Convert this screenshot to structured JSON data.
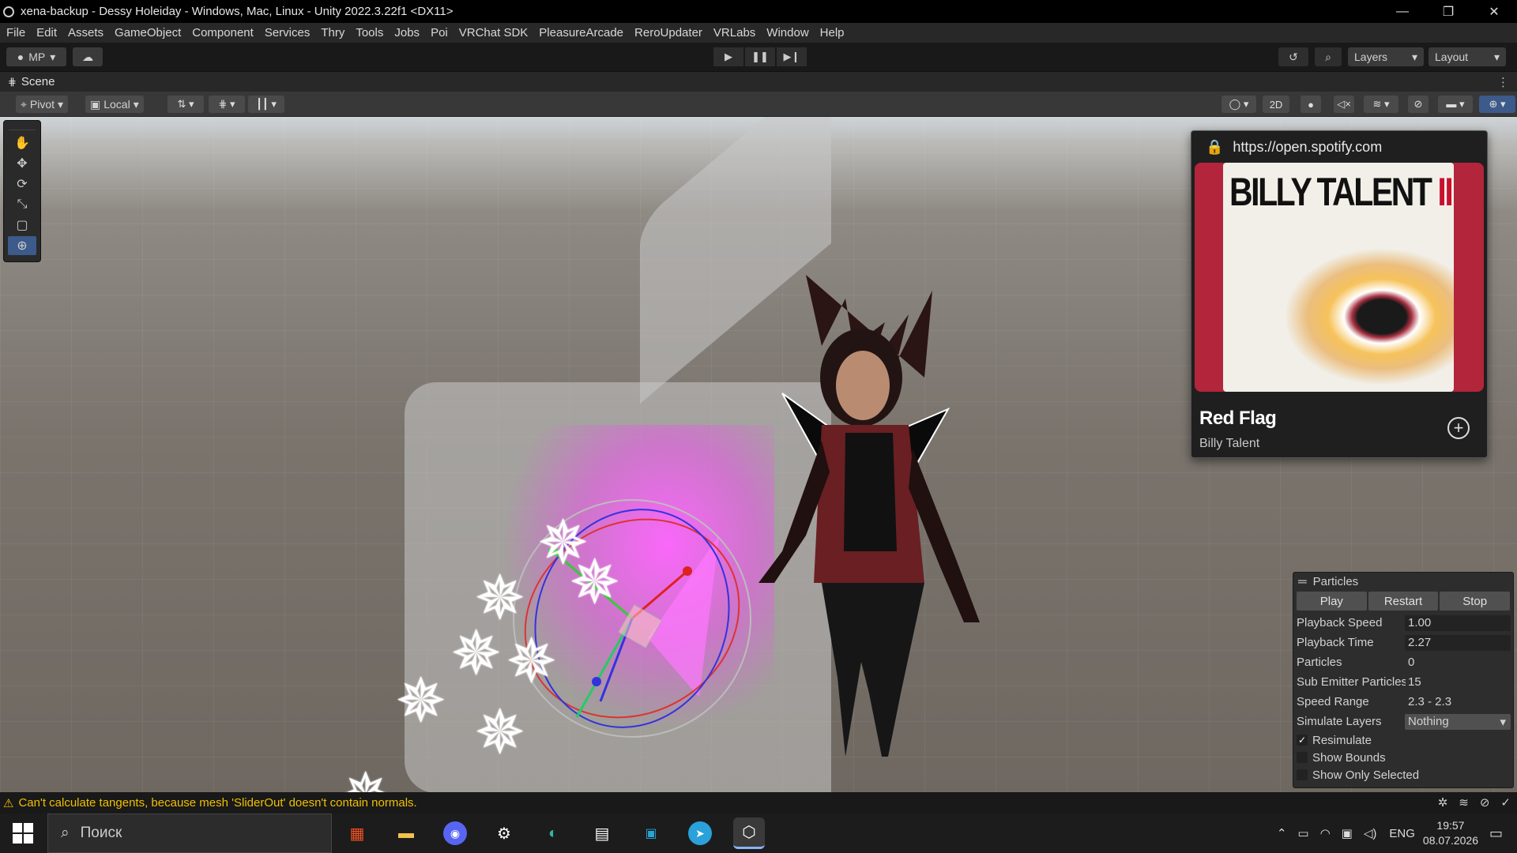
{
  "window": {
    "title": "xena-backup - Dessy Holeiday - Windows, Mac, Linux - Unity 2022.3.22f1 <DX11>",
    "controls": [
      "—",
      "❐",
      "✕"
    ]
  },
  "menu": [
    "File",
    "Edit",
    "Assets",
    "GameObject",
    "Component",
    "Services",
    "Thry",
    "Tools",
    "Jobs",
    "Poi",
    "VRChat SDK",
    "PleasureArcade",
    "ReroUpdater",
    "VRLabs",
    "Window",
    "Help"
  ],
  "toolbar": {
    "account_label": "MP",
    "layers_label": "Layers",
    "layout_label": "Layout"
  },
  "scene_tab": {
    "label": "Scene"
  },
  "scene_toolbar": {
    "pivot_label": "Pivot",
    "local_label": "Local",
    "mode_2d_label": "2D"
  },
  "spotify": {
    "url": "https://open.spotify.com",
    "album_art_text": "BILLY TALENT",
    "album_art_numeral": "II",
    "song_title": "Red Flag",
    "artist": "Billy Talent",
    "colors": {
      "cover_bg": "#b3253a",
      "panel_bg": "#1f1f1f"
    }
  },
  "particles": {
    "title": "Particles",
    "buttons": [
      "Play",
      "Restart",
      "Stop"
    ],
    "rows": [
      {
        "label": "Playback Speed",
        "value": "1.00",
        "kind": "field"
      },
      {
        "label": "Playback Time",
        "value": "2.27",
        "kind": "field"
      },
      {
        "label": "Particles",
        "value": "0",
        "kind": "plain"
      },
      {
        "label": "Sub Emitter Particles",
        "value": "15",
        "kind": "plain"
      },
      {
        "label": "Speed Range",
        "value": "2.3 - 2.3",
        "kind": "plain"
      },
      {
        "label": "Simulate Layers",
        "value": "Nothing",
        "kind": "select"
      }
    ],
    "checks": [
      {
        "label": "Resimulate",
        "checked": true
      },
      {
        "label": "Show Bounds",
        "checked": false
      },
      {
        "label": "Show Only Selected",
        "checked": false
      }
    ]
  },
  "status": {
    "message": "Can't calculate tangents, because mesh 'SliderOut' doesn't contain normals.",
    "warning_color": "#f5c000"
  },
  "taskbar": {
    "search_placeholder": "Поиск",
    "language": "ENG",
    "time": "19:57",
    "date": "08.07.2026"
  }
}
